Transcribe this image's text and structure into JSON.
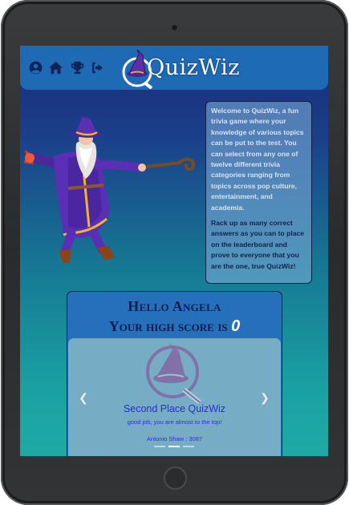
{
  "navbar": {
    "icons": [
      "user-circle-icon",
      "home-icon",
      "trophy-icon",
      "sign-out-icon"
    ],
    "logo_text": "QuizWiz",
    "color": "#1e6ab4"
  },
  "intro": {
    "paragraph1": "Welcome to QuizWiz, a fun trivia game where your knowledge of various topics can be put to the test. You can select from any one of twelve different trivia categories ranging from topics across pop culture, entertainment, and academia.",
    "paragraph2": "Rack up as many correct answers as you can to place on the leaderboard and prove to everyone that you are the one, true QuizWiz!"
  },
  "score_card": {
    "greeting": "Hello Angela",
    "high_score_label": "Your high score is",
    "high_score_value": "0"
  },
  "carousel": {
    "title": "Second Place QuizWiz",
    "subtitle": "good job, you are almost to the top!",
    "entry": "Antonio Shaw : 3087",
    "prev_icon": "chevron-left-icon",
    "next_icon": "chevron-right-icon",
    "slide_count": 3,
    "active_slide": 2
  },
  "colors": {
    "accent_text": "#2a2ae0",
    "heading_text": "#101b4a"
  }
}
